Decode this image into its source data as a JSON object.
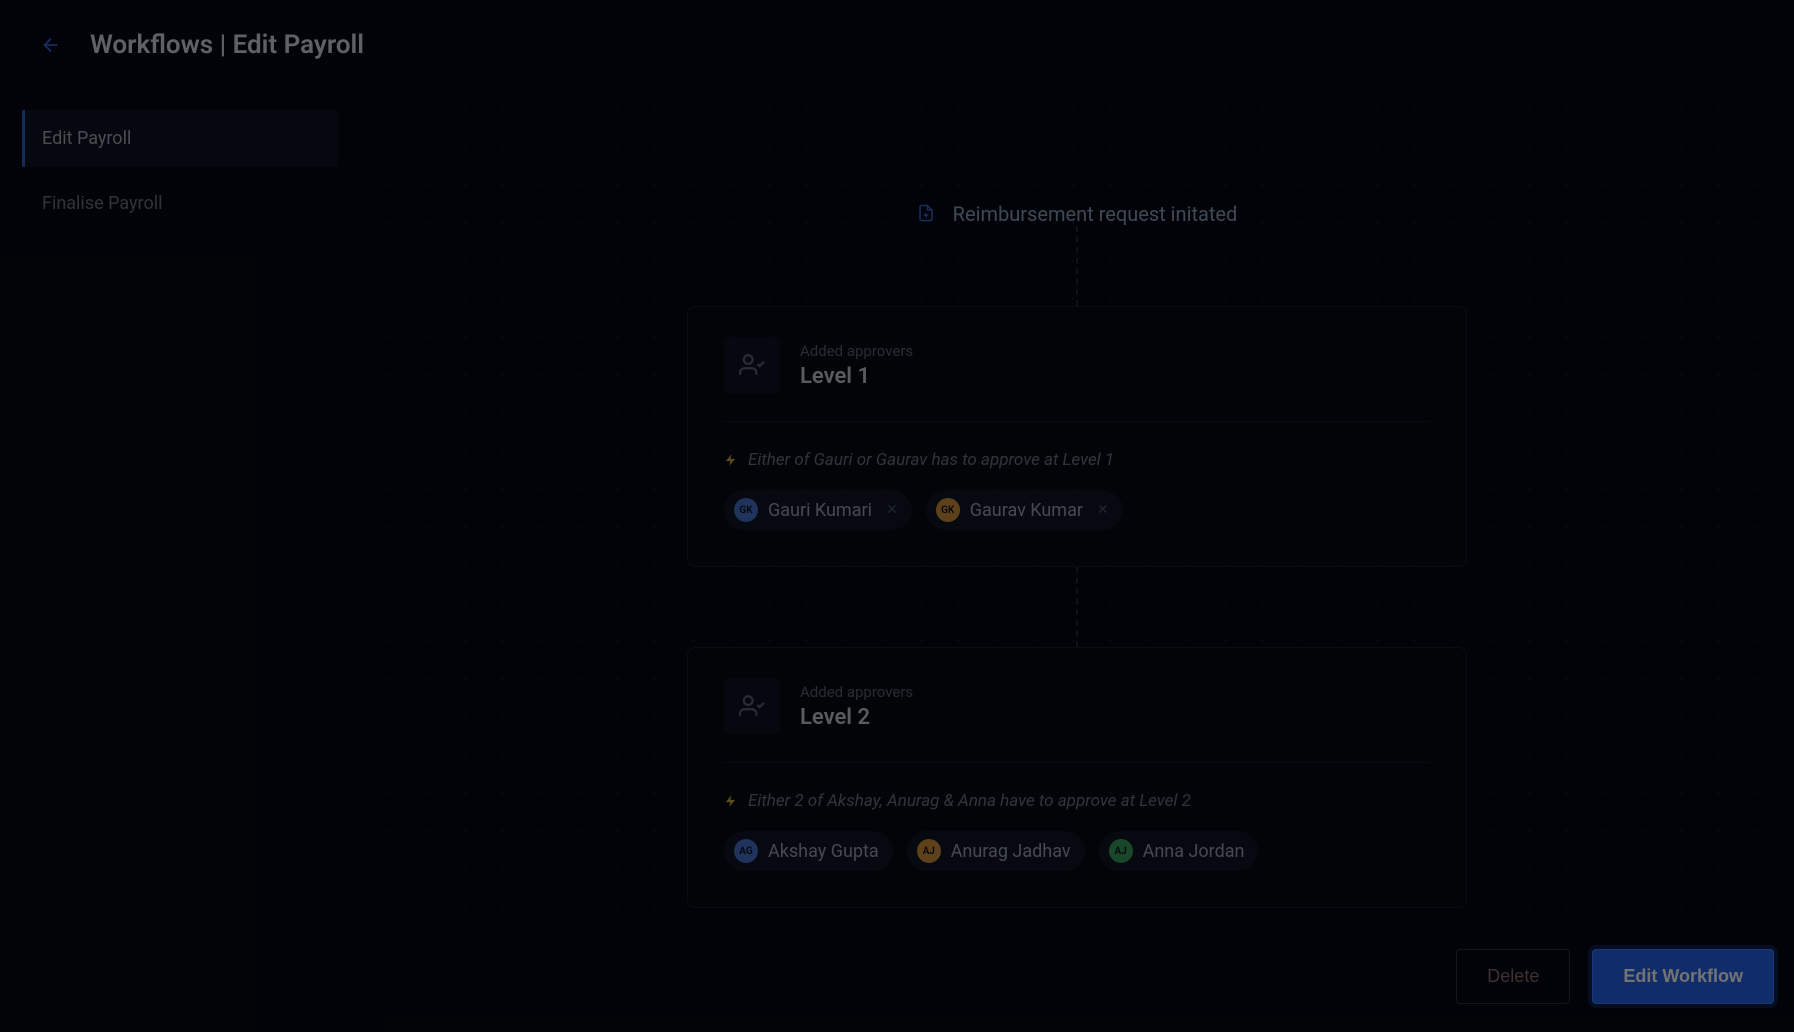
{
  "header": {
    "title": "Workflows | Edit Payroll"
  },
  "sidebar": {
    "items": [
      {
        "label": "Edit Payroll",
        "active": true
      },
      {
        "label": "Finalise Payroll",
        "active": false
      }
    ]
  },
  "workflow": {
    "initiator": "Reimbursement request initated",
    "levels": [
      {
        "subtitle": "Added approvers",
        "title": "Level 1",
        "rule": "Either of Gauri or Gaurav has to approve at Level 1",
        "approvers": [
          {
            "initials": "GK",
            "name": "Gauri Kumari",
            "color": "blue"
          },
          {
            "initials": "GK",
            "name": "Gaurav Kumar",
            "color": "orange"
          }
        ]
      },
      {
        "subtitle": "Added approvers",
        "title": "Level 2",
        "rule": "Either 2 of Akshay, Anurag & Anna have to approve at Level 2",
        "approvers": [
          {
            "initials": "AG",
            "name": "Akshay Gupta",
            "color": "blue"
          },
          {
            "initials": "AJ",
            "name": "Anurag Jadhav",
            "color": "orange"
          },
          {
            "initials": "AJ",
            "name": "Anna Jordan",
            "color": "green"
          }
        ]
      }
    ]
  },
  "footer": {
    "delete": "Delete",
    "edit": "Edit Workflow"
  }
}
